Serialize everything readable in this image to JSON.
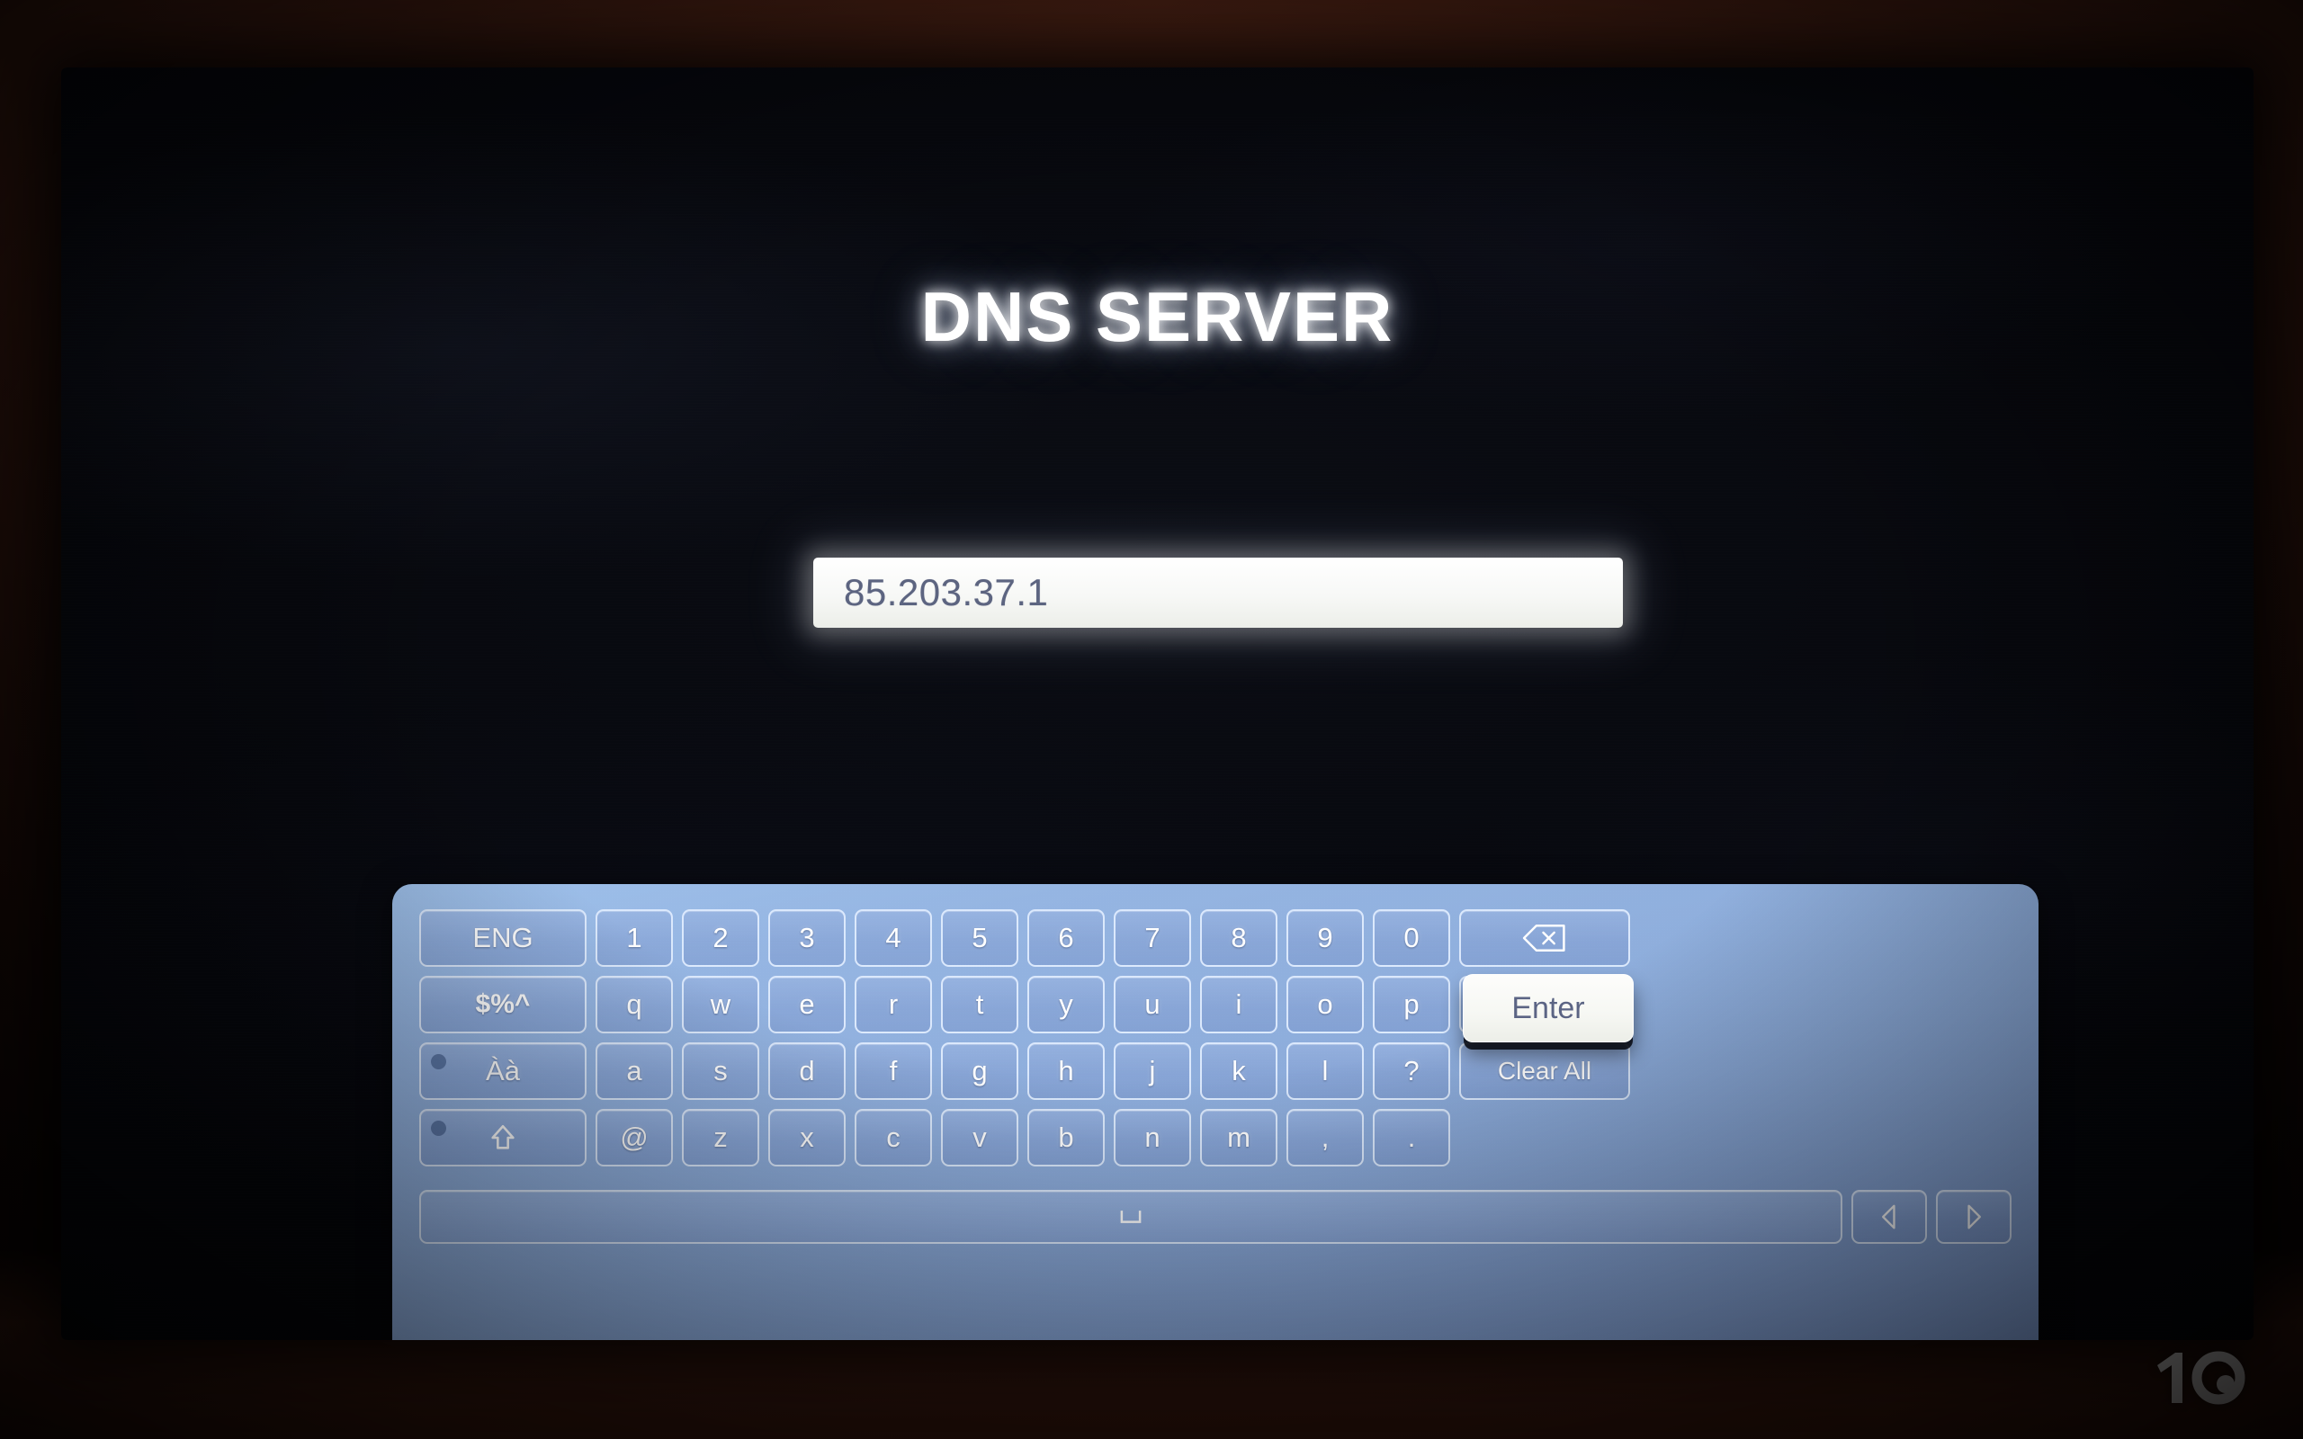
{
  "screen": {
    "title": "DNS SERVER"
  },
  "input": {
    "value": "85.203.37.1",
    "placeholder": ""
  },
  "keyboard": {
    "left_column": [
      {
        "label": "ENG",
        "name": "language-key",
        "dot": false
      },
      {
        "label": "$%^",
        "name": "symbols-key",
        "dot": false
      },
      {
        "label": "Àà",
        "name": "accents-key",
        "dot": true
      },
      {
        "label": "⇧",
        "name": "shift-key",
        "dot": true
      }
    ],
    "rows": [
      [
        "1",
        "2",
        "3",
        "4",
        "5",
        "6",
        "7",
        "8",
        "9",
        "0"
      ],
      [
        "q",
        "w",
        "e",
        "r",
        "t",
        "y",
        "u",
        "i",
        "o",
        "p"
      ],
      [
        "a",
        "s",
        "d",
        "f",
        "g",
        "h",
        "j",
        "k",
        "l",
        "?"
      ],
      [
        "@",
        "z",
        "x",
        "c",
        "v",
        "b",
        "n",
        "m",
        ",",
        "."
      ]
    ],
    "right_column": [
      {
        "label": "",
        "name": "backspace-key",
        "icon": "backspace-icon"
      },
      {
        "label": "",
        "name": "microphone-key",
        "icon": "microphone-icon"
      },
      {
        "label": "Clear All",
        "name": "clear-all-key",
        "icon": ""
      }
    ],
    "enter": {
      "label": "Enter",
      "selected": true
    },
    "space": {
      "label": "␣",
      "name": "space-key"
    },
    "arrows": [
      {
        "label": "◁",
        "name": "cursor-left-key"
      },
      {
        "label": "▷",
        "name": "cursor-right-key"
      }
    ]
  },
  "watermark": {
    "label": "10"
  },
  "colors": {
    "keyboard_panel": "#8aa9d8",
    "key_fill": "#7d93c8",
    "key_border": "#e2eeff",
    "selected_key_bg": "#fdfdfb",
    "selected_key_text": "#5b6484",
    "input_text": "#5c6480",
    "title_text": "#ffffff",
    "screen_bg": "#05060b",
    "room_bg": "#30150d"
  }
}
